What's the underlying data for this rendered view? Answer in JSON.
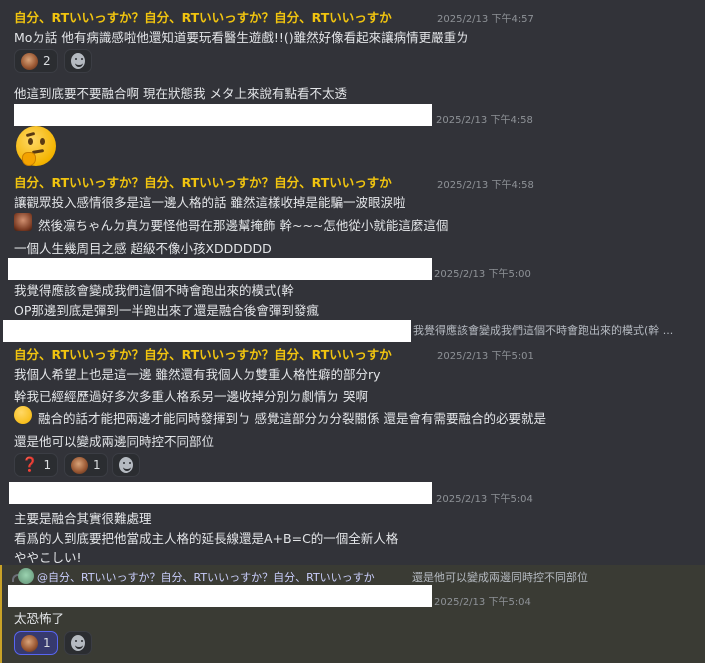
{
  "username": "自分、RTいいっすか？自分、RTいいっすか？自分、RTいいっすか",
  "messages": {
    "m1": {
      "time": "2025/2/13 下午4:57",
      "line1": "Moㄉ話 他有病識感啦他還知道要玩看醫生遊戲!!()雖然好像看起來讓病情更嚴重ㄌ",
      "reaction_count": "2",
      "line2": "他這到底要不要融合啊 現在狀態我 メタ上來說有點看不太透"
    },
    "m2": {
      "time": "2025/2/13 下午4:58",
      "emoji": "thinking-face"
    },
    "m3": {
      "time": "2025/2/13 下午4:58",
      "line1": "讓觀眾投入感情很多是這一邊人格的話 雖然這樣收掉是能騙一波眼淚啦",
      "line2": "然後凛ちゃんㄉ真ㄉ要怪他哥在那邊幫掩飾 幹~~~怎他從小就能這麼這個",
      "line3": "一個人生幾周目之感 超級不像小孩XDDDDDD"
    },
    "m4": {
      "time": "2025/2/13 下午5:00",
      "line1": "我覺得應該會變成我們這個不時會跑出來的模式(幹",
      "line2": "OP那邊到底是彈到一半跑出來了還是融合後會彈到發瘋",
      "quote_preview": "我覺得應該會變成我們這個不時會跑出來的模式(幹 ..."
    },
    "m5": {
      "time": "2025/2/13 下午5:01",
      "line1": "我個人希望上也是這一邊 雖然還有我個人ㄉ雙重人格性癖的部分ry",
      "line2": "幹我已經經歷過好多次多重人格系另一邊收掉分別ㄉ劇情ㄉ 哭啊",
      "line3": "融合的話才能把兩邊才能同時發揮到ㄅ 感覺這部分ㄉ分裂關係 還是會有需要融合的必要就是",
      "line4": "還是他可以變成兩邊同時控不同部位",
      "r1_count": "1",
      "r2_count": "1"
    },
    "m6": {
      "time": "2025/2/13 下午5:04",
      "line1": "主要是融合其實很難處理",
      "line2": "看爲的人到底要把他當成主人格的延長線還是A+B=C的一個全新人格",
      "line3": "ややこしい!"
    },
    "reply": {
      "mention": "@自分、RTいいっすか？自分、RTいいっすか？自分、RTいいっすか",
      "text": "還是他可以變成兩邊同時控不同部位"
    },
    "m7": {
      "time": "2025/2/13 下午5:04",
      "line1": "太恐怖了",
      "reaction_count": "1"
    }
  },
  "colors": {
    "background": "#323339",
    "username": "#f1c40f",
    "timestamp": "#8e9297",
    "text": "#e3e5e8",
    "reaction_active": "#5865f2"
  }
}
